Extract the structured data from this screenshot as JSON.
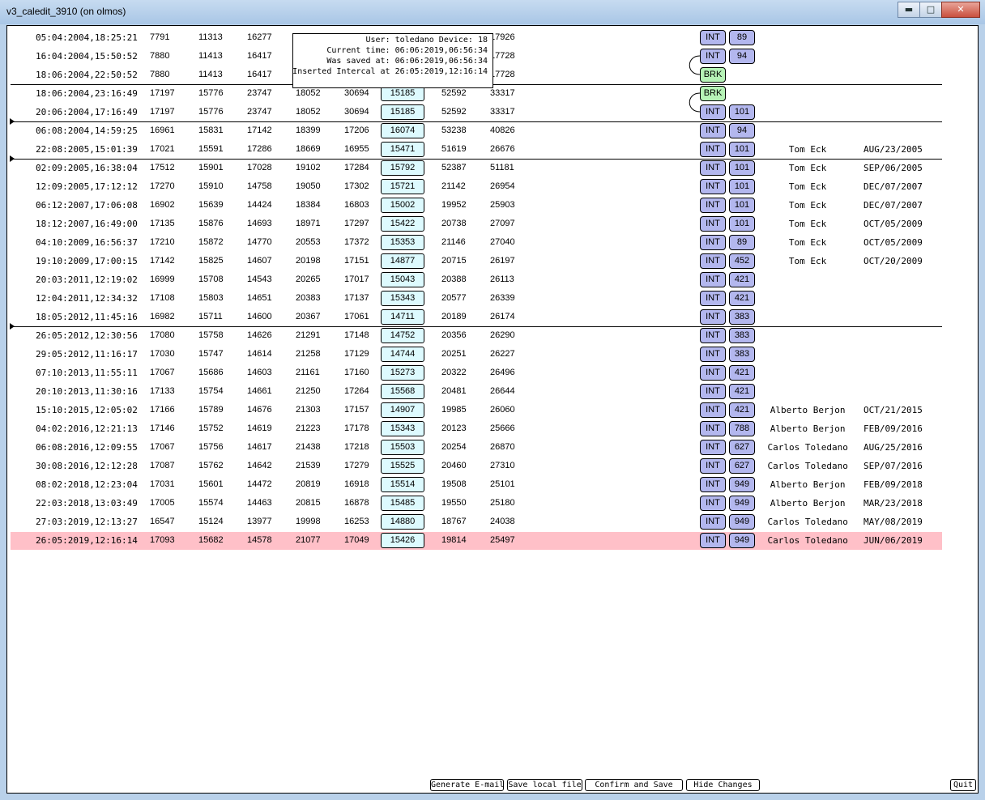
{
  "window": {
    "title": "v3_caledit_3910 (on olmos)"
  },
  "tooltip": {
    "lines": [
      "User: toledano Device: 18",
      "Current time: 06:06:2019,06:56:34",
      "Was saved at: 06:06:2019,06:56:34",
      "Inserted Intercal at 26:05:2019,12:16:14"
    ]
  },
  "rows": [
    {
      "date": "05:04:2004,18:25:21",
      "v1": "7791",
      "v2": "11313",
      "v3": "16277",
      "v4": "",
      "v5": "",
      "box": "",
      "v6": "",
      "v7": "17926",
      "tag": "INT",
      "code": "89",
      "name": "",
      "sig": ""
    },
    {
      "date": "16:04:2004,15:50:52",
      "v1": "7880",
      "v2": "11413",
      "v3": "16417",
      "v4": "",
      "v5": "",
      "box": "",
      "v6": "",
      "v7": "17728",
      "tag": "INT",
      "code": "94",
      "name": "",
      "sig": ""
    },
    {
      "date": "18:06:2004,22:50:52",
      "v1": "7880",
      "v2": "11413",
      "v3": "16417",
      "v4": "",
      "v5": "",
      "box": "",
      "v6": "",
      "v7": "17728",
      "tag": "BRK",
      "code": "",
      "name": "",
      "sig": ""
    },
    {
      "date": "18:06:2004,23:16:49",
      "v1": "17197",
      "v2": "15776",
      "v3": "23747",
      "v4": "18052",
      "v5": "30694",
      "box": "15185",
      "v6": "52592",
      "v7": "33317",
      "tag": "BRK",
      "code": "",
      "name": "",
      "sig": ""
    },
    {
      "date": "20:06:2004,17:16:49",
      "v1": "17197",
      "v2": "15776",
      "v3": "23747",
      "v4": "18052",
      "v5": "30694",
      "box": "15185",
      "v6": "52592",
      "v7": "33317",
      "tag": "INT",
      "code": "101",
      "name": "",
      "sig": ""
    },
    {
      "date": "06:08:2004,14:59:25",
      "v1": "16961",
      "v2": "15831",
      "v3": "17142",
      "v4": "18399",
      "v5": "17206",
      "box": "16074",
      "v6": "53238",
      "v7": "40826",
      "tag": "INT",
      "code": "94",
      "name": "",
      "sig": ""
    },
    {
      "date": "22:08:2005,15:01:39",
      "v1": "17021",
      "v2": "15591",
      "v3": "17286",
      "v4": "18669",
      "v5": "16955",
      "box": "15471",
      "v6": "51619",
      "v7": "26676",
      "tag": "INT",
      "code": "101",
      "name": "Tom Eck",
      "sig": "AUG/23/2005"
    },
    {
      "date": "02:09:2005,16:38:04",
      "v1": "17512",
      "v2": "15901",
      "v3": "17028",
      "v4": "19102",
      "v5": "17284",
      "box": "15792",
      "v6": "52387",
      "v7": "51181",
      "tag": "INT",
      "code": "101",
      "name": "Tom Eck",
      "sig": "SEP/06/2005"
    },
    {
      "date": "12:09:2005,17:12:12",
      "v1": "17270",
      "v2": "15910",
      "v3": "14758",
      "v4": "19050",
      "v5": "17302",
      "box": "15721",
      "v6": "21142",
      "v7": "26954",
      "tag": "INT",
      "code": "101",
      "name": "Tom Eck",
      "sig": "DEC/07/2007"
    },
    {
      "date": "06:12:2007,17:06:08",
      "v1": "16902",
      "v2": "15639",
      "v3": "14424",
      "v4": "18384",
      "v5": "16803",
      "box": "15002",
      "v6": "19952",
      "v7": "25903",
      "tag": "INT",
      "code": "101",
      "name": "Tom Eck",
      "sig": "DEC/07/2007"
    },
    {
      "date": "18:12:2007,16:49:00",
      "v1": "17135",
      "v2": "15876",
      "v3": "14693",
      "v4": "18971",
      "v5": "17297",
      "box": "15422",
      "v6": "20738",
      "v7": "27097",
      "tag": "INT",
      "code": "101",
      "name": "Tom Eck",
      "sig": "OCT/05/2009"
    },
    {
      "date": "04:10:2009,16:56:37",
      "v1": "17210",
      "v2": "15872",
      "v3": "14770",
      "v4": "20553",
      "v5": "17372",
      "box": "15353",
      "v6": "21146",
      "v7": "27040",
      "tag": "INT",
      "code": "89",
      "name": "Tom Eck",
      "sig": "OCT/05/2009"
    },
    {
      "date": "19:10:2009,17:00:15",
      "v1": "17142",
      "v2": "15825",
      "v3": "14607",
      "v4": "20198",
      "v5": "17151",
      "box": "14877",
      "v6": "20715",
      "v7": "26197",
      "tag": "INT",
      "code": "452",
      "name": "Tom Eck",
      "sig": "OCT/20/2009"
    },
    {
      "date": "20:03:2011,12:19:02",
      "v1": "16999",
      "v2": "15708",
      "v3": "14543",
      "v4": "20265",
      "v5": "17017",
      "box": "15043",
      "v6": "20388",
      "v7": "26113",
      "tag": "INT",
      "code": "421",
      "name": "",
      "sig": ""
    },
    {
      "date": "12:04:2011,12:34:32",
      "v1": "17108",
      "v2": "15803",
      "v3": "14651",
      "v4": "20383",
      "v5": "17137",
      "box": "15343",
      "v6": "20577",
      "v7": "26339",
      "tag": "INT",
      "code": "421",
      "name": "",
      "sig": ""
    },
    {
      "date": "18:05:2012,11:45:16",
      "v1": "16982",
      "v2": "15711",
      "v3": "14600",
      "v4": "20367",
      "v5": "17061",
      "box": "14711",
      "v6": "20189",
      "v7": "26174",
      "tag": "INT",
      "code": "383",
      "name": "",
      "sig": ""
    },
    {
      "date": "26:05:2012,12:30:56",
      "v1": "17080",
      "v2": "15758",
      "v3": "14626",
      "v4": "21291",
      "v5": "17148",
      "box": "14752",
      "v6": "20356",
      "v7": "26290",
      "tag": "INT",
      "code": "383",
      "name": "",
      "sig": ""
    },
    {
      "date": "29:05:2012,11:16:17",
      "v1": "17030",
      "v2": "15747",
      "v3": "14614",
      "v4": "21258",
      "v5": "17129",
      "box": "14744",
      "v6": "20251",
      "v7": "26227",
      "tag": "INT",
      "code": "383",
      "name": "",
      "sig": ""
    },
    {
      "date": "07:10:2013,11:55:11",
      "v1": "17067",
      "v2": "15686",
      "v3": "14603",
      "v4": "21161",
      "v5": "17160",
      "box": "15273",
      "v6": "20322",
      "v7": "26496",
      "tag": "INT",
      "code": "421",
      "name": "",
      "sig": ""
    },
    {
      "date": "20:10:2013,11:30:16",
      "v1": "17133",
      "v2": "15754",
      "v3": "14661",
      "v4": "21250",
      "v5": "17264",
      "box": "15568",
      "v6": "20481",
      "v7": "26644",
      "tag": "INT",
      "code": "421",
      "name": "",
      "sig": ""
    },
    {
      "date": "15:10:2015,12:05:02",
      "v1": "17166",
      "v2": "15789",
      "v3": "14676",
      "v4": "21303",
      "v5": "17157",
      "box": "14907",
      "v6": "19985",
      "v7": "26060",
      "tag": "INT",
      "code": "421",
      "name": "Alberto Berjon",
      "sig": "OCT/21/2015"
    },
    {
      "date": "04:02:2016,12:21:13",
      "v1": "17146",
      "v2": "15752",
      "v3": "14619",
      "v4": "21223",
      "v5": "17178",
      "box": "15343",
      "v6": "20123",
      "v7": "25666",
      "tag": "INT",
      "code": "788",
      "name": "Alberto Berjon",
      "sig": "FEB/09/2016"
    },
    {
      "date": "06:08:2016,12:09:55",
      "v1": "17067",
      "v2": "15756",
      "v3": "14617",
      "v4": "21438",
      "v5": "17218",
      "box": "15503",
      "v6": "20254",
      "v7": "26870",
      "tag": "INT",
      "code": "627",
      "name": "Carlos Toledano",
      "sig": "AUG/25/2016"
    },
    {
      "date": "30:08:2016,12:12:28",
      "v1": "17087",
      "v2": "15762",
      "v3": "14642",
      "v4": "21539",
      "v5": "17279",
      "box": "15525",
      "v6": "20460",
      "v7": "27310",
      "tag": "INT",
      "code": "627",
      "name": "Carlos Toledano",
      "sig": "SEP/07/2016"
    },
    {
      "date": "08:02:2018,12:23:04",
      "v1": "17031",
      "v2": "15601",
      "v3": "14472",
      "v4": "20819",
      "v5": "16918",
      "box": "15514",
      "v6": "19508",
      "v7": "25101",
      "tag": "INT",
      "code": "949",
      "name": "Alberto Berjon",
      "sig": "FEB/09/2018"
    },
    {
      "date": "22:03:2018,13:03:49",
      "v1": "17005",
      "v2": "15574",
      "v3": "14463",
      "v4": "20815",
      "v5": "16878",
      "box": "15485",
      "v6": "19550",
      "v7": "25180",
      "tag": "INT",
      "code": "949",
      "name": "Alberto Berjon",
      "sig": "MAR/23/2018"
    },
    {
      "date": "27:03:2019,12:13:27",
      "v1": "16547",
      "v2": "15124",
      "v3": "13977",
      "v4": "19998",
      "v5": "16253",
      "box": "14880",
      "v6": "18767",
      "v7": "24038",
      "tag": "INT",
      "code": "949",
      "name": "Carlos Toledano",
      "sig": "MAY/08/2019"
    },
    {
      "date": "26:05:2019,12:16:14",
      "v1": "17093",
      "v2": "15682",
      "v3": "14578",
      "v4": "21077",
      "v5": "17049",
      "box": "15426",
      "v6": "19814",
      "v7": "25497",
      "tag": "INT",
      "code": "949",
      "name": "Carlos Toledano",
      "sig": "JUN/06/2019"
    }
  ],
  "buttons": {
    "email": "Generate E-mail",
    "save_local": "Save local file",
    "confirm": "Confirm and Save",
    "hide": "Hide Changes",
    "quit": "Quit"
  },
  "colors": {
    "highlight": "#ffc0c8",
    "int_pill": "#b3b7ee",
    "brk_pill": "#b6f3b6",
    "value_box": "#ddfafe"
  }
}
